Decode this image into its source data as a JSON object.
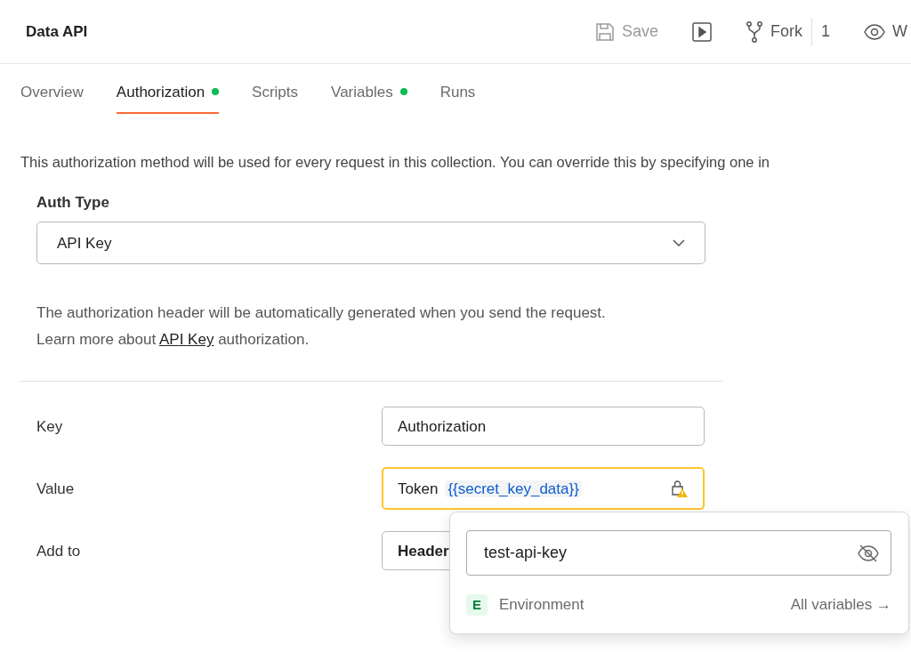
{
  "header": {
    "title": "Data API",
    "actions": [
      {
        "kind": "save",
        "label": "Save",
        "disabled": true
      },
      {
        "kind": "run"
      },
      {
        "kind": "fork",
        "label": "Fork",
        "count": "1"
      },
      {
        "kind": "watch",
        "label": "W"
      }
    ]
  },
  "tabs": [
    {
      "label": "Overview",
      "selected": false,
      "has_dot": false
    },
    {
      "label": "Authorization",
      "selected": true,
      "has_dot": true
    },
    {
      "label": "Scripts",
      "selected": false,
      "has_dot": false
    },
    {
      "label": "Variables",
      "selected": false,
      "has_dot": true
    },
    {
      "label": "Runs",
      "selected": false,
      "has_dot": false
    }
  ],
  "description": "This authorization method will be used for every request in this collection. You can override this by specifying one in",
  "auth_type": {
    "label": "Auth Type",
    "value": "API Key"
  },
  "help": {
    "line1": "The authorization header will be automatically generated when you send the request.",
    "line2_before": "Learn more about",
    "link": "API Key",
    "line2_after": "authorization."
  },
  "fields": [
    {
      "kind": "text",
      "label": "Key",
      "value": "Authorization"
    },
    {
      "kind": "token",
      "label": "Value",
      "prefix": "Token",
      "variable": "{{secret_key_data}}",
      "warning": true
    },
    {
      "kind": "select",
      "label": "Add to",
      "value": "Header"
    }
  ],
  "popover": {
    "value": "test-api-key",
    "scope_badge": "E",
    "scope": "Environment",
    "link": "All variables →"
  }
}
